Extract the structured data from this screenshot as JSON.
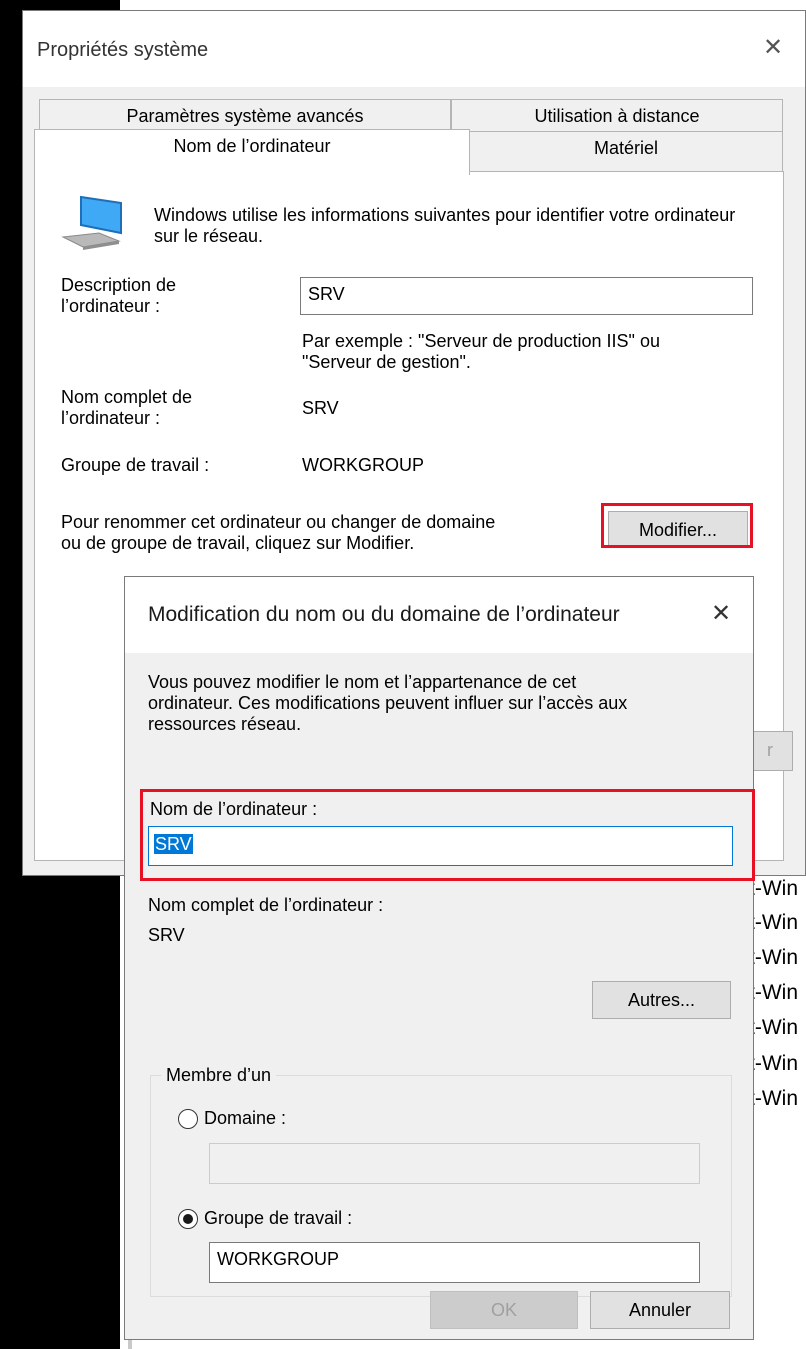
{
  "background": {
    "fragments": [
      "t-Win",
      "t-Win",
      "t-Win",
      "t-Win",
      "t-Win",
      "t-Win",
      "t-Win"
    ]
  },
  "sys_props": {
    "title": "Propriétés système",
    "close_glyph": "✕",
    "tabs": {
      "advanced": "Paramètres système avancés",
      "remote": "Utilisation à distance",
      "computer_name": "Nom de l’ordinateur",
      "hardware": "Matériel"
    },
    "intro": "Windows utilise les informations suivantes pour identifier votre ordinateur sur le réseau.",
    "description_label_1": "Description de",
    "description_label_2": "l’ordinateur :",
    "description_value": "SRV",
    "example_1": "Par exemple : \"Serveur de production IIS\" ou",
    "example_2": "\"Serveur de gestion\".",
    "fullname_label_1": "Nom complet de",
    "fullname_label_2": "l’ordinateur :",
    "fullname_value": "SRV",
    "workgroup_label": "Groupe de travail :",
    "workgroup_value": "WORKGROUP",
    "rename_hint_1": "Pour renommer cet ordinateur ou changer de domaine",
    "rename_hint_2": "ou de groupe de travail, cliquez sur Modifier.",
    "modify_button": "Modifier...",
    "hidden_button_fragment": "r"
  },
  "rename_dialog": {
    "title": "Modification du nom ou du domaine de l’ordinateur",
    "close_glyph": "✕",
    "intro_1": "Vous pouvez modifier le nom et l’appartenance de cet",
    "intro_2": "ordinateur. Ces modifications peuvent influer sur l’accès aux",
    "intro_3": "ressources réseau.",
    "computer_name_label": "Nom de l’ordinateur :",
    "computer_name_value": "SRV",
    "fullname_label": "Nom complet de l’ordinateur :",
    "fullname_value": "SRV",
    "more_button": "Autres...",
    "member_of_label": "Membre d’un",
    "domain_label": "Domaine :",
    "domain_value": "",
    "workgroup_label": "Groupe de travail :",
    "workgroup_value": "WORKGROUP",
    "member_selected": "workgroup",
    "ok_button": "OK",
    "cancel_button": "Annuler"
  },
  "colors": {
    "highlight_box": "#e81123",
    "selection": "#0078d7",
    "focus_border": "#0078d7"
  }
}
